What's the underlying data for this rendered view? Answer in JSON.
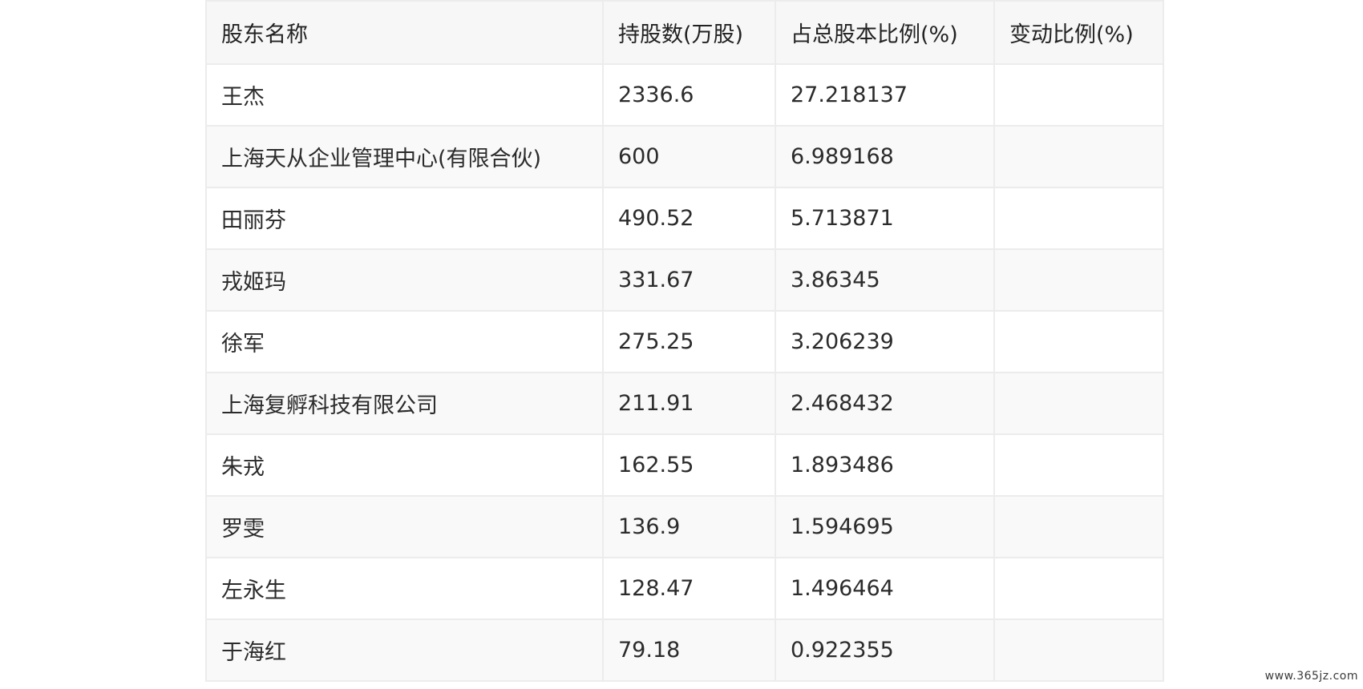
{
  "table": {
    "headers": [
      "股东名称",
      "持股数(万股)",
      "占总股本比例(%)",
      "变动比例(%)"
    ],
    "rows": [
      [
        "王杰",
        "2336.6",
        "27.218137",
        ""
      ],
      [
        "上海天从企业管理中心(有限合伙)",
        "600",
        "6.989168",
        ""
      ],
      [
        "田丽芬",
        "490.52",
        "5.713871",
        ""
      ],
      [
        "戎姬玛",
        "331.67",
        "3.86345",
        ""
      ],
      [
        "徐军",
        "275.25",
        "3.206239",
        ""
      ],
      [
        "上海复孵科技有限公司",
        "211.91",
        "2.468432",
        ""
      ],
      [
        "朱戎",
        "162.55",
        "1.893486",
        ""
      ],
      [
        "罗雯",
        "136.9",
        "1.594695",
        ""
      ],
      [
        "左永生",
        "128.47",
        "1.496464",
        ""
      ],
      [
        "于海红",
        "79.18",
        "0.922355",
        ""
      ]
    ]
  },
  "watermark": "www.365jz.com"
}
